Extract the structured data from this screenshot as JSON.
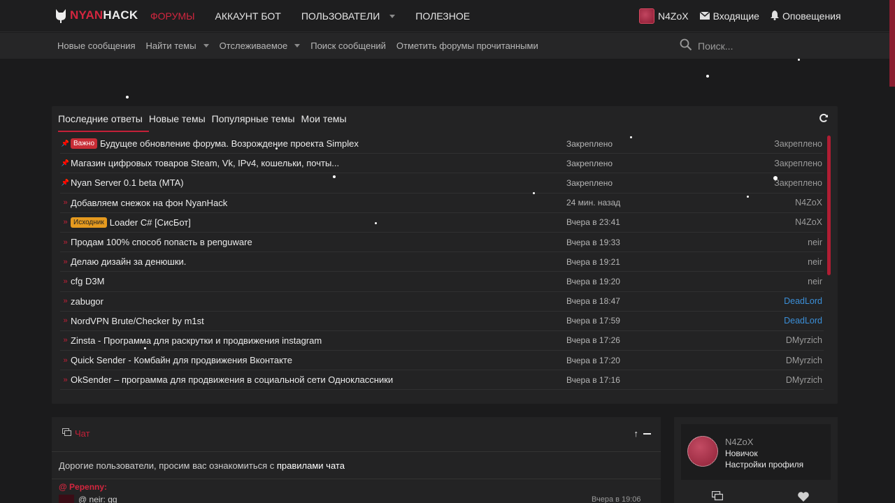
{
  "logo": {
    "part1": "NYAN",
    "part2": "HACK"
  },
  "nav": [
    {
      "label": "ФОРУМЫ",
      "active": true,
      "dropdown": false
    },
    {
      "label": "АККАУНТ БОТ",
      "active": false,
      "dropdown": false
    },
    {
      "label": "ПОЛЬЗОВАТЕЛИ",
      "active": false,
      "dropdown": true
    },
    {
      "label": "ПОЛЕЗНОЕ",
      "active": false,
      "dropdown": false
    }
  ],
  "user": {
    "name": "N4ZoX",
    "inbox": "Входящие",
    "alerts": "Оповещения"
  },
  "subnav": [
    {
      "label": "Новые сообщения",
      "dropdown": false
    },
    {
      "label": "Найти темы",
      "dropdown": true
    },
    {
      "label": "Отслеживаемое",
      "dropdown": true
    },
    {
      "label": "Поиск сообщений",
      "dropdown": false
    },
    {
      "label": "Отметить форумы прочитанными",
      "dropdown": false
    }
  ],
  "search": {
    "placeholder": "Поиск..."
  },
  "threads": {
    "tabs": [
      "Последние ответы",
      "Новые темы",
      "Популярные темы",
      "Мои темы"
    ],
    "rows": [
      {
        "pinned": true,
        "badge": "Важно",
        "badge_color": "red",
        "title": "Будущее обновление форума. Возрождение проекта Simplex",
        "date": "Закреплено",
        "user": "Закреплено",
        "user_blue": false
      },
      {
        "pinned": true,
        "badge": "",
        "badge_color": "",
        "title": "Магазин цифровых товаров Steam, Vk, IPv4, кошельки, почты...",
        "date": "Закреплено",
        "user": "Закреплено",
        "user_blue": false
      },
      {
        "pinned": true,
        "badge": "",
        "badge_color": "",
        "title": "Nyan Server 0.1 beta (MTA)",
        "date": "Закреплено",
        "user": "Закреплено",
        "user_blue": false
      },
      {
        "pinned": false,
        "badge": "",
        "badge_color": "",
        "title": "Добавляем снежок на фон NyanHack",
        "date": "24 мин. назад",
        "user": "N4ZoX",
        "user_blue": false
      },
      {
        "pinned": false,
        "badge": "Исходник",
        "badge_color": "orange",
        "title": "Loader C# [СисБот]",
        "date": "Вчера в 23:41",
        "user": "N4ZoX",
        "user_blue": false
      },
      {
        "pinned": false,
        "badge": "",
        "badge_color": "",
        "title": "Продам 100% способ попасть в penguware",
        "date": "Вчера в 19:33",
        "user": "neir",
        "user_blue": false
      },
      {
        "pinned": false,
        "badge": "",
        "badge_color": "",
        "title": "Делаю дизайн за денюшки.",
        "date": "Вчера в 19:21",
        "user": "neir",
        "user_blue": false
      },
      {
        "pinned": false,
        "badge": "",
        "badge_color": "",
        "title": "cfg D3M",
        "date": "Вчера в 19:20",
        "user": "neir",
        "user_blue": false
      },
      {
        "pinned": false,
        "badge": "",
        "badge_color": "",
        "title": "zabugor",
        "date": "Вчера в 18:47",
        "user": "DeadLord",
        "user_blue": true
      },
      {
        "pinned": false,
        "badge": "",
        "badge_color": "",
        "title": "NordVPN Brute/Checker by m1st",
        "date": "Вчера в 17:59",
        "user": "DeadLord",
        "user_blue": true
      },
      {
        "pinned": false,
        "badge": "",
        "badge_color": "",
        "title": "Zinsta - Программа для раскрутки и продвижения instagram",
        "date": "Вчера в 17:26",
        "user": "DMyrzich",
        "user_blue": false
      },
      {
        "pinned": false,
        "badge": "",
        "badge_color": "",
        "title": "Quick Sender - Комбайн для продвижения Вконтакте",
        "date": "Вчера в 17:20",
        "user": "DMyrzich",
        "user_blue": false
      },
      {
        "pinned": false,
        "badge": "",
        "badge_color": "",
        "title": "OkSender – программа для продвижения в социальной сети Одноклассники",
        "date": "Вчера в 17:16",
        "user": "DMyrzich",
        "user_blue": false
      }
    ]
  },
  "chat": {
    "title": "Чат",
    "notice_text": "Дорогие пользователи, просим вас ознакомиться с ",
    "notice_link": "правилами чата",
    "msg1_user": "@ Pepenny:",
    "msg2_text": "@ neir: gg",
    "msg2_time": "Вчера в 19:06"
  },
  "profile": {
    "name": "N4ZoX",
    "rank": "Новичок",
    "settings": "Настройки профиля"
  },
  "colors": {
    "accent": "#c42038",
    "link_blue": "#3b8fd8",
    "badge_orange": "#e59a1f"
  }
}
